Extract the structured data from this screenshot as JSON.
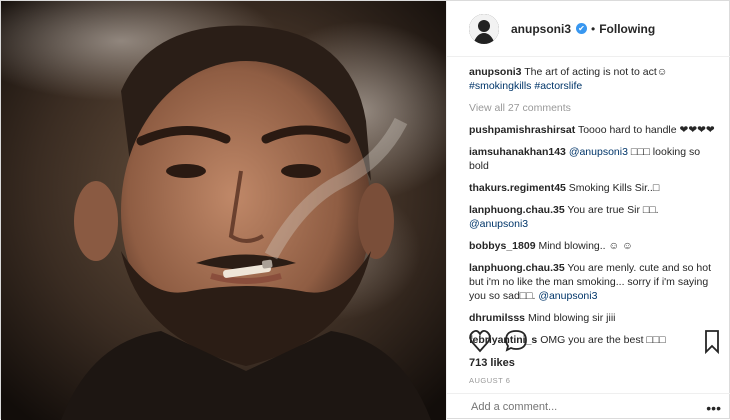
{
  "header": {
    "username": "anupsoni3",
    "verified_mark": "✔",
    "separator": "•",
    "follow_state": "Following"
  },
  "caption": {
    "username": "anupsoni3",
    "text": "The art of acting is not to act☺",
    "hashtags": "#smokingkills #actorslife"
  },
  "view_all": "View all 27 comments",
  "comments": [
    {
      "user": "pushpamishrashirsat",
      "text": "Toooo hard to handle ❤❤❤❤"
    },
    {
      "user": "iamsuhanakhan143",
      "mention": "@anupsoni3",
      "text": "□□□ looking so bold"
    },
    {
      "user": "thakurs.regiment45",
      "text": "Smoking Kills Sir..□"
    },
    {
      "user": "lanphuong.chau.35",
      "text": "You are true Sir □□.",
      "mention_after": "@anupsoni3"
    },
    {
      "user": "bobbys_1809",
      "text": "Mind blowing.. ☺ ☺"
    },
    {
      "user": "lanphuong.chau.35",
      "text": "You are menly. cute and so hot but i'm no like the man smoking... sorry if i'm saying you so sad□□.",
      "mention_after": "@anupsoni3"
    },
    {
      "user": "dhrumilsss",
      "text": "Mind blowing sir jiii"
    },
    {
      "user": "febriyantini_s",
      "text": "OMG you are the best □□□"
    }
  ],
  "likes": "713 likes",
  "date": "AUGUST 6",
  "add_comment_placeholder": "Add a comment...",
  "more_label": "•••",
  "icons": [
    "heart-icon",
    "comment-icon",
    "bookmark-icon"
  ]
}
